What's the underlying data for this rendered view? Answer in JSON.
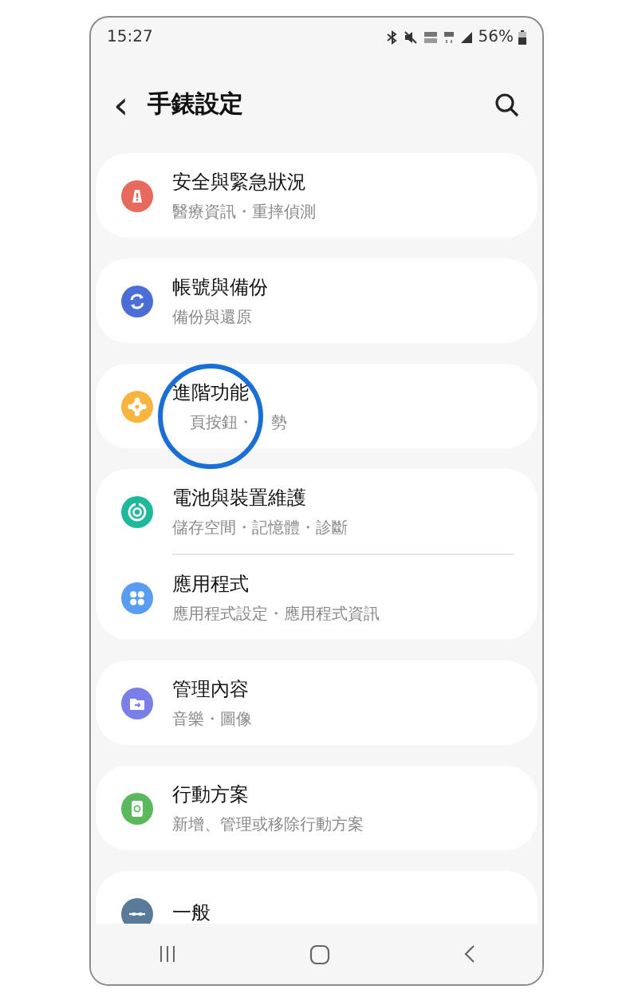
{
  "status_bar": {
    "time": "15:27",
    "battery": "56%"
  },
  "header": {
    "back": "‹",
    "title": "手錶設定"
  },
  "groups": [
    {
      "items": [
        {
          "title": "安全與緊急狀況",
          "subtitle": "醫療資訊・重摔偵測",
          "color": "#e8695e"
        }
      ]
    },
    {
      "items": [
        {
          "title": "帳號與備份",
          "subtitle": "備份與還原",
          "color": "#4b6ed6"
        }
      ]
    },
    {
      "items": [
        {
          "title": "進階功能",
          "subtitle_parts": [
            "頁按鈕・",
            "勢"
          ],
          "color": "#f9b33f",
          "circled": true
        }
      ]
    },
    {
      "items": [
        {
          "title": "電池與裝置維護",
          "subtitle": "儲存空間・記憶體・診斷",
          "color": "#1fb89b"
        },
        {
          "title": "應用程式",
          "subtitle": "應用程式設定・應用程式資訊",
          "color": "#5a9cef"
        }
      ]
    },
    {
      "items": [
        {
          "title": "管理內容",
          "subtitle": "音樂・圖像",
          "color": "#7a7fe8"
        }
      ]
    },
    {
      "items": [
        {
          "title": "行動方案",
          "subtitle": "新增、管理或移除行動方案",
          "color": "#5cb85c"
        }
      ]
    },
    {
      "items": [
        {
          "title": "一般",
          "color": "#5a7a99"
        }
      ]
    }
  ]
}
